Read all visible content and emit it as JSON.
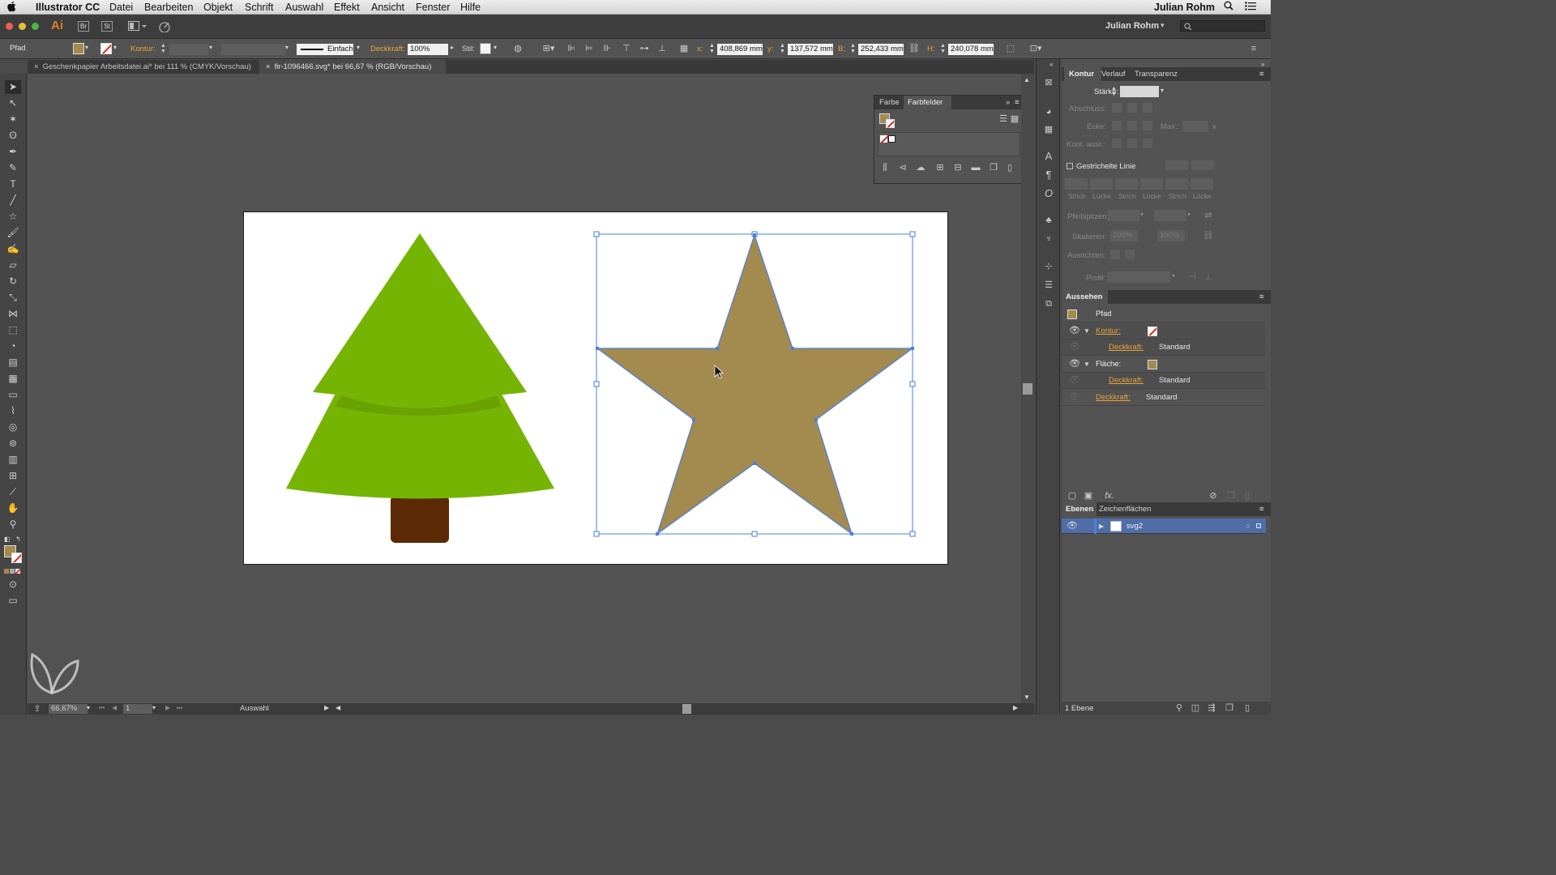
{
  "menubar": {
    "app": "Illustrator CC",
    "items": [
      "Datei",
      "Bearbeiten",
      "Objekt",
      "Schrift",
      "Auswahl",
      "Effekt",
      "Ansicht",
      "Fenster",
      "Hilfe"
    ],
    "user": "Julian Rohm"
  },
  "controlbar": {
    "logo": "Ai",
    "br": "Br",
    "st": "St",
    "user": "Julian Rohm"
  },
  "options": {
    "selection_label": "Pfad",
    "kontur_label": "Kontur:",
    "stroke_style": "Einfach",
    "deckkraft_label": "Deckkraft:",
    "deckkraft_value": "100%",
    "stil_label": "Stil:",
    "x_label": "x:",
    "x_value": "408,869 mm",
    "y_label": "y:",
    "y_value": "137,572 mm",
    "b_label": "B:",
    "b_value": "252,433 mm",
    "h_label": "H:",
    "h_value": "240,078 mm"
  },
  "tabs": [
    {
      "label": "Geschenkpapier Arbeitsdatei.ai* bei 111 % (CMYK/Vorschau)",
      "active": false
    },
    {
      "label": "fir-1096466.svg* bei 66,67 % (RGB/Vorschau)",
      "active": true
    }
  ],
  "colors": {
    "tree_green": "#76b404",
    "tree_shadow": "#6aa203",
    "trunk": "#5b2a05",
    "star_fill": "#a38a4e",
    "selection": "#4a7fe0",
    "accent_orange": "#e8a33a"
  },
  "farbe_panel": {
    "tab1": "Farbe",
    "tab2": "Farbfelder"
  },
  "kontur_panel": {
    "tab1": "Kontur",
    "tab2": "Verlauf",
    "tab3": "Transparenz",
    "staerke": "Stärke:",
    "abschluss": "Abschluss:",
    "ecke": "Ecke:",
    "max": "Max.:",
    "x_suffix": "x",
    "kont_ausr": "Kont. ausr.:",
    "gestrichelt": "Gestrichelte Linie",
    "dash_labels": [
      "Strich",
      "Lücke",
      "Strich",
      "Lücke",
      "Strich",
      "Lücke"
    ],
    "pfeilspitzen": "Pfeilspitzen:",
    "skalieren": "Skalieren:",
    "skal_val1": "100%",
    "skal_val2": "100%",
    "ausrichten": "Ausrichten:",
    "profil": "Profil:"
  },
  "aussehen_panel": {
    "title": "Aussehen",
    "object": "Pfad",
    "kontur": "Kontur:",
    "deckkraft": "Deckkraft:",
    "standard": "Standard",
    "flaeche": "Fläche:",
    "fx": "fx."
  },
  "ebenen_panel": {
    "tab1": "Ebenen",
    "tab2": "Zeichenflächen",
    "layer": "svg2",
    "count": "1 Ebene"
  },
  "status": {
    "zoom": "66,67%",
    "page": "1",
    "mode": "Auswahl"
  }
}
